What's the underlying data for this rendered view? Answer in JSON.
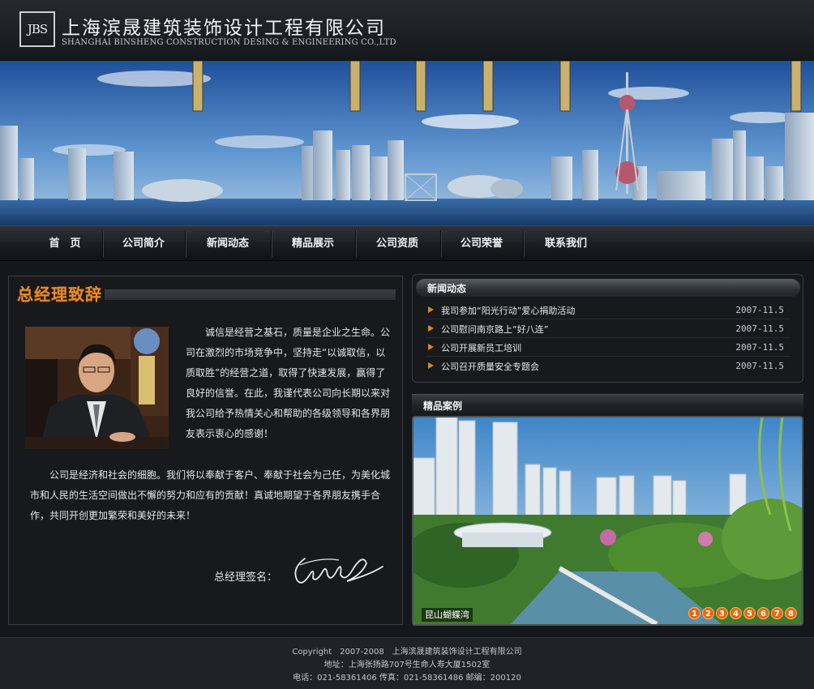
{
  "header": {
    "logo_text": "JBS",
    "company_cn": "上海滨晟建筑装饰设计工程有限公司",
    "company_en": "SHANGHAI BINSHENG CONSTRUCTION DESING & ENGINEERING CO.,LTD"
  },
  "nav": {
    "items": [
      {
        "label": "首　页"
      },
      {
        "label": "公司简介"
      },
      {
        "label": "新闻动态"
      },
      {
        "label": "精品展示"
      },
      {
        "label": "公司资质"
      },
      {
        "label": "公司荣誉"
      },
      {
        "label": "联系我们"
      }
    ]
  },
  "intro": {
    "title": "总经理致辞",
    "paragraph1": "诚信是经营之基石，质量是企业之生命。公司在激烈的市场竞争中，坚持走“以诚取信，以质取胜”的经营之道，取得了快速发展，赢得了良好的信誉。在此，我谨代表公司向长期以来对我公司给予热情关心和帮助的各级领导和各界朋友表示衷心的感谢！",
    "paragraph2": "公司是经济和社会的细胞。我们将以奉献于客户、奉献于社会为己任，为美化城市和人民的生活空间做出不懈的努力和应有的贡献！真诚地期望于各界朋友携手合作，共同开创更加繁荣和美好的未来！",
    "signature_label": "总经理签名："
  },
  "news": {
    "title": "新闻动态",
    "items": [
      {
        "title": "我司参加“阳光行动”爱心捐助活动",
        "date": "2007-11.5"
      },
      {
        "title": "公司慰问南京路上“好八连”",
        "date": "2007-11.5"
      },
      {
        "title": "公司开展新员工培训",
        "date": "2007-11.5"
      },
      {
        "title": "公司召开质量安全专题会",
        "date": "2007-11.5"
      }
    ]
  },
  "cases": {
    "title": "精品案例",
    "caption": "昆山蝴蝶湾",
    "pages": [
      "1",
      "2",
      "3",
      "4",
      "5",
      "6",
      "7",
      "8"
    ]
  },
  "footer": {
    "copyright": "Copyright　2007-2008　上海滨晟建筑装饰设计工程有限公司",
    "address": "地址：上海张扬路707号生命人寿大厦1502室",
    "contact": "电话：021-58361406 传真：021-58361486 邮编：200120"
  },
  "colors": {
    "accent_orange": "#e88a28",
    "background": "#14171b",
    "panel_border": "#3a3f45"
  }
}
